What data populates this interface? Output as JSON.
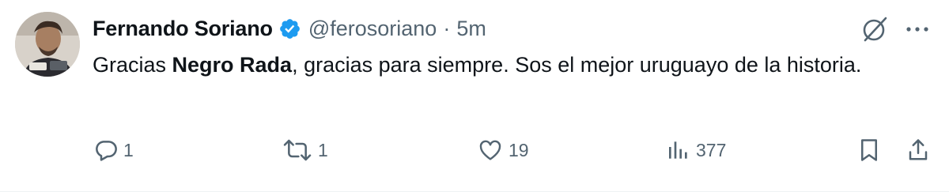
{
  "tweet": {
    "author": {
      "display_name": "Fernando Soriano",
      "handle": "@ferosoriano",
      "separator": "·",
      "timestamp": "5m",
      "avatar_icon": "avatar-photo",
      "verified_icon": "verified-badge-icon",
      "verified_color": "#1d9bf0"
    },
    "text": {
      "part1": "Gracias ",
      "bold": "Negro Rada",
      "part2": ", gracias para siempre. Sos el mejor uruguayo de la historia."
    },
    "actions": {
      "reply": {
        "icon": "reply-icon",
        "count": "1"
      },
      "retweet": {
        "icon": "retweet-icon",
        "count": "1"
      },
      "like": {
        "icon": "heart-icon",
        "count": "19"
      },
      "views": {
        "icon": "analytics-icon",
        "count": "377"
      },
      "bookmark": {
        "icon": "bookmark-icon"
      },
      "share": {
        "icon": "share-icon"
      }
    },
    "top_icons": {
      "grok": "grok-icon",
      "more": "more-icon"
    },
    "colors": {
      "text": "#0f1419",
      "secondary": "#536471",
      "accent": "#1d9bf0",
      "divider": "#eff3f4"
    }
  }
}
